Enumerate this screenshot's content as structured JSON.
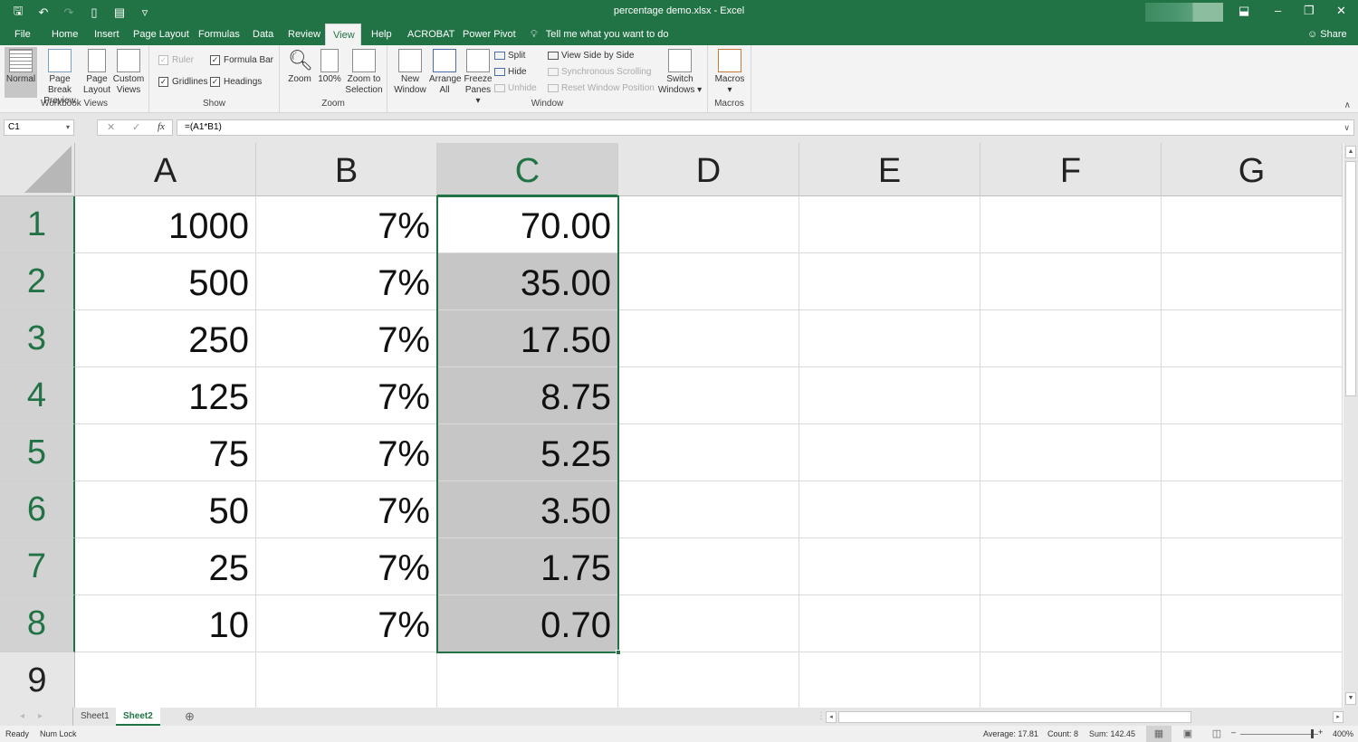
{
  "titlebar": {
    "title": "percentage demo.xlsx  -  Excel",
    "qat": {
      "save_icon": "💾",
      "undo_icon": "↶",
      "redo_icon": "↷",
      "new_icon": "🗎",
      "form_icon": "▤",
      "customize_icon": "▿"
    },
    "controls": {
      "ribbon_display": "⬓",
      "minimize": "–",
      "restore": "❐",
      "close": "✕"
    }
  },
  "tabs": [
    {
      "label": "File",
      "active": false
    },
    {
      "label": "Home",
      "active": false
    },
    {
      "label": "Insert",
      "active": false
    },
    {
      "label": "Page Layout",
      "active": false
    },
    {
      "label": "Formulas",
      "active": false
    },
    {
      "label": "Data",
      "active": false
    },
    {
      "label": "Review",
      "active": false
    },
    {
      "label": "View",
      "active": true
    },
    {
      "label": "Help",
      "active": false
    },
    {
      "label": "ACROBAT",
      "active": false
    },
    {
      "label": "Power Pivot",
      "active": false
    }
  ],
  "tell_me": {
    "icon": "💡",
    "placeholder": "Tell me what you want to do"
  },
  "share": {
    "icon": "👤",
    "label": "Share"
  },
  "ribbon": {
    "workbook_views": {
      "label": "Workbook Views",
      "normal": "Normal",
      "page_break_1": "Page Break",
      "page_break_2": "Preview",
      "page_layout_1": "Page",
      "page_layout_2": "Layout",
      "custom_1": "Custom",
      "custom_2": "Views"
    },
    "show": {
      "label": "Show",
      "ruler": {
        "label": "Ruler",
        "checked": true,
        "disabled": true
      },
      "formula_bar": {
        "label": "Formula Bar",
        "checked": true
      },
      "gridlines": {
        "label": "Gridlines",
        "checked": true
      },
      "headings": {
        "label": "Headings",
        "checked": true
      }
    },
    "zoom": {
      "label": "Zoom",
      "zoom": "Zoom",
      "hundred": "100%",
      "zoom_sel_1": "Zoom to",
      "zoom_sel_2": "Selection"
    },
    "window": {
      "label": "Window",
      "new_window_1": "New",
      "new_window_2": "Window",
      "arrange_1": "Arrange",
      "arrange_2": "All",
      "freeze_1": "Freeze",
      "freeze_2": "Panes ▾",
      "split": "Split",
      "hide": "Hide",
      "unhide": "Unhide",
      "side_by_side": "View Side by Side",
      "sync_scroll": "Synchronous Scrolling",
      "reset_pos": "Reset Window Position",
      "switch_1": "Switch",
      "switch_2": "Windows ▾"
    },
    "macros": {
      "label": "Macros",
      "macros_1": "Macros",
      "macros_2": "▾"
    },
    "collapse_icon": "∧"
  },
  "formula_bar": {
    "name_box": "C1",
    "cancel_icon": "✕",
    "enter_icon": "✓",
    "fx_icon": "fx",
    "formula": "=(A1*B1)"
  },
  "grid": {
    "columns": [
      "A",
      "B",
      "C",
      "D",
      "E",
      "F",
      "G"
    ],
    "selected_column": "C",
    "rows": [
      {
        "num": "1",
        "A": "1000",
        "B": "7%",
        "C": "70.00"
      },
      {
        "num": "2",
        "A": "500",
        "B": "7%",
        "C": "35.00"
      },
      {
        "num": "3",
        "A": "250",
        "B": "7%",
        "C": "17.50"
      },
      {
        "num": "4",
        "A": "125",
        "B": "7%",
        "C": "8.75"
      },
      {
        "num": "5",
        "A": "75",
        "B": "7%",
        "C": "5.25"
      },
      {
        "num": "6",
        "A": "50",
        "B": "7%",
        "C": "3.50"
      },
      {
        "num": "7",
        "A": "25",
        "B": "7%",
        "C": "1.75"
      },
      {
        "num": "8",
        "A": "10",
        "B": "7%",
        "C": "0.70"
      },
      {
        "num": "9",
        "A": "",
        "B": "",
        "C": ""
      }
    ],
    "active_cell": "C1",
    "selection": "C1:C8"
  },
  "sheets": {
    "tabs": [
      {
        "label": "Sheet1",
        "active": false
      },
      {
        "label": "Sheet2",
        "active": true
      }
    ],
    "add_icon": "⊕",
    "prev_icon": "◂",
    "next_icon": "▸"
  },
  "status": {
    "ready": "Ready",
    "num_lock": "Num Lock",
    "average": "Average: 17.81",
    "count": "Count: 8",
    "sum": "Sum: 142.45",
    "zoom_level": "400%",
    "zoom_minus": "–",
    "zoom_plus": "+",
    "normal_view_icon": "▦",
    "page_layout_icon": "▣",
    "page_break_icon": "◫"
  },
  "colors": {
    "accent": "#217346",
    "selection_fill": "#c6c6c6"
  }
}
